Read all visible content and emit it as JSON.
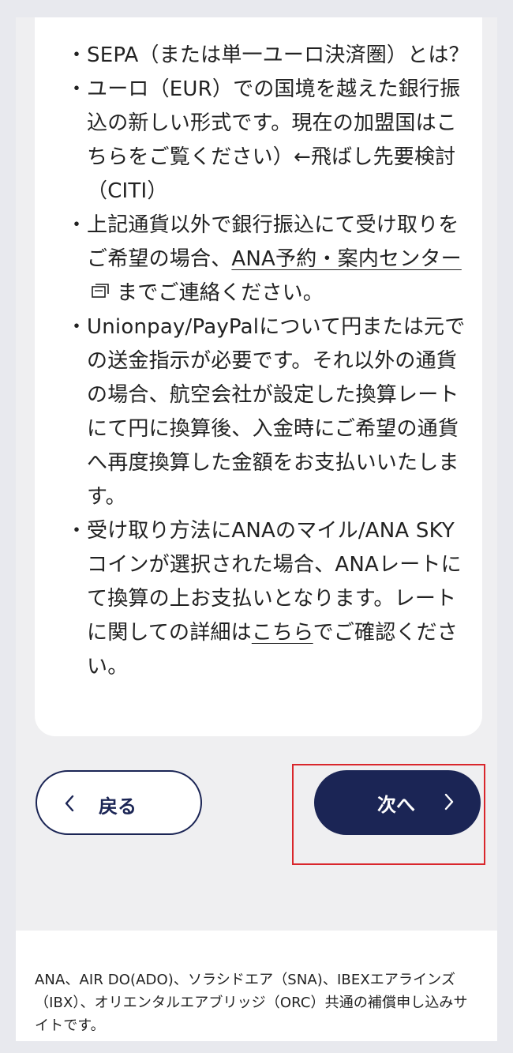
{
  "notes": [
    {
      "type": "text",
      "text": "SEPA（または単一ユーロ決済圏）とは？"
    },
    {
      "type": "text",
      "text": "ユーロ（EUR）での国境を越えた銀行振込の新しい形式です。現在の加盟国はこちらをご覧ください）←飛ばし先要検討（CITI）"
    },
    {
      "type": "link",
      "before": "上記通貨以外で銀行振込にて受け取りをご希望の場合、",
      "link": "ANA予約・案内センター",
      "after": "までご連絡ください。",
      "icon": "external-link-icon"
    },
    {
      "type": "text",
      "text": "Unionpay/PayPalについて円または元での送金指示が必要です。それ以外の通貨の場合、航空会社が設定した換算レートにて円に換算後、入金時にご希望の通貨へ再度換算した金額をお支払いいたします。"
    },
    {
      "type": "link",
      "before": "受け取り方法にANAのマイル/ANA SKY コインが選択された場合、ANAレートにて換算の上お支払いとなります。レートに関しての詳細は",
      "link": "こちら",
      "after": "でご確認ください。"
    }
  ],
  "bullet": "・",
  "buttons": {
    "back_label": "戻る",
    "next_label": "次へ"
  },
  "footer": {
    "text": "ANA、AIR DO(ADO)、ソラシドエア（SNA)、IBEXエアラインズ（IBX）、オリエンタルエアブリッジ（ORC）共通の補償申し込みサイトです。"
  },
  "colors": {
    "navy": "#1b2555",
    "highlight": "#d9262c",
    "background": "#e8e9ee",
    "card": "#ffffff"
  }
}
